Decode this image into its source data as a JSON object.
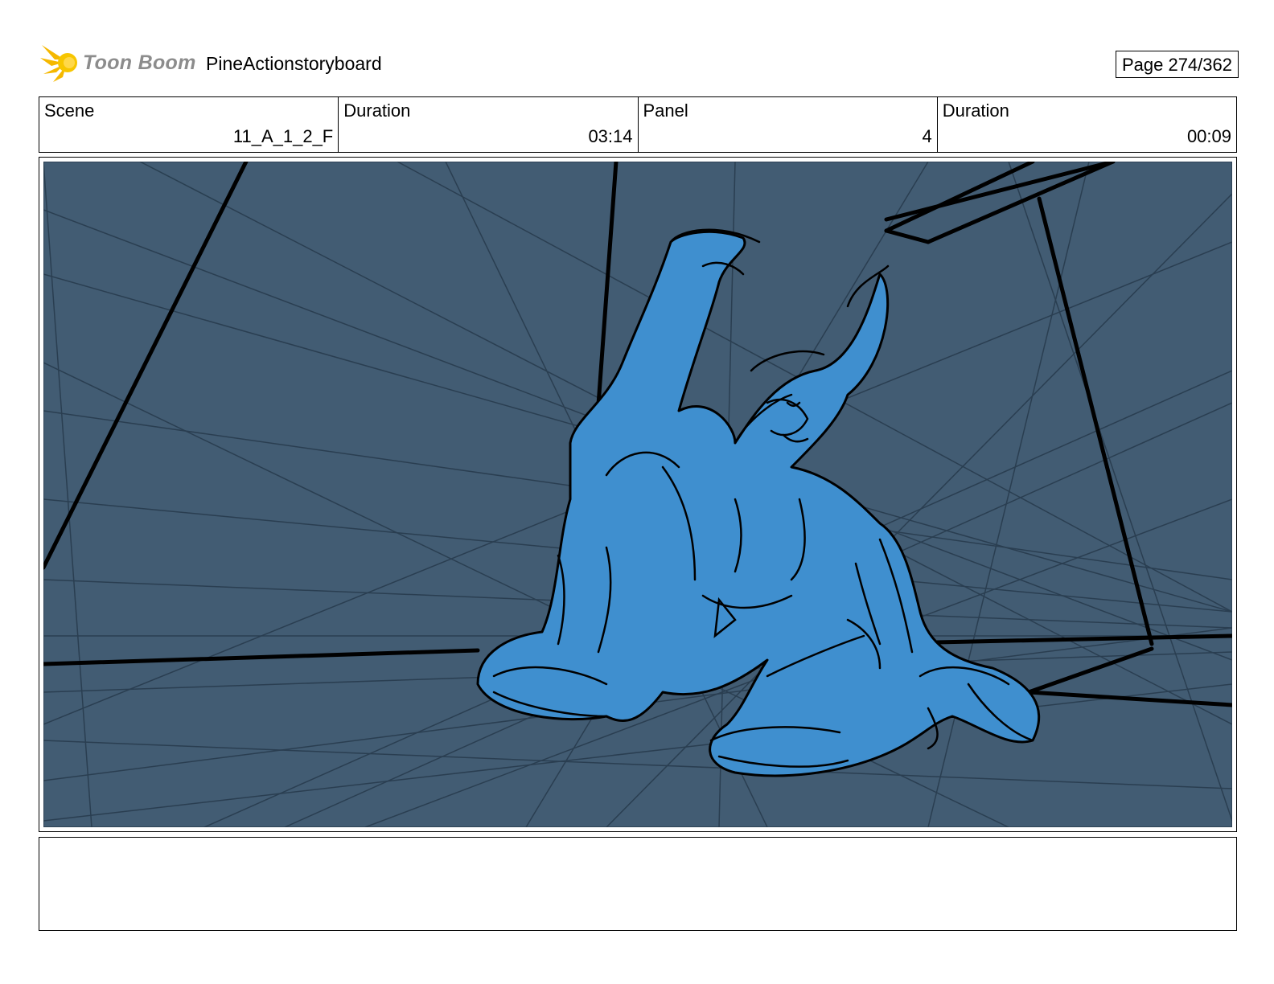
{
  "header": {
    "logo_text": "Toon Boom",
    "project_title": "PineActionstoryboard",
    "page_label": "Page 274/362"
  },
  "meta": {
    "scene_label": "Scene",
    "scene_value": "11_A_1_2_F",
    "scene_duration_label": "Duration",
    "scene_duration_value": "03:14",
    "panel_label": "Panel",
    "panel_value": "4",
    "panel_duration_label": "Duration",
    "panel_duration_value": "00:09"
  },
  "panel": {
    "background_color": "#425c73",
    "character_color": "#3f8fcf",
    "character_highlight": "#5aa6e0"
  },
  "notes": {
    "text": ""
  }
}
